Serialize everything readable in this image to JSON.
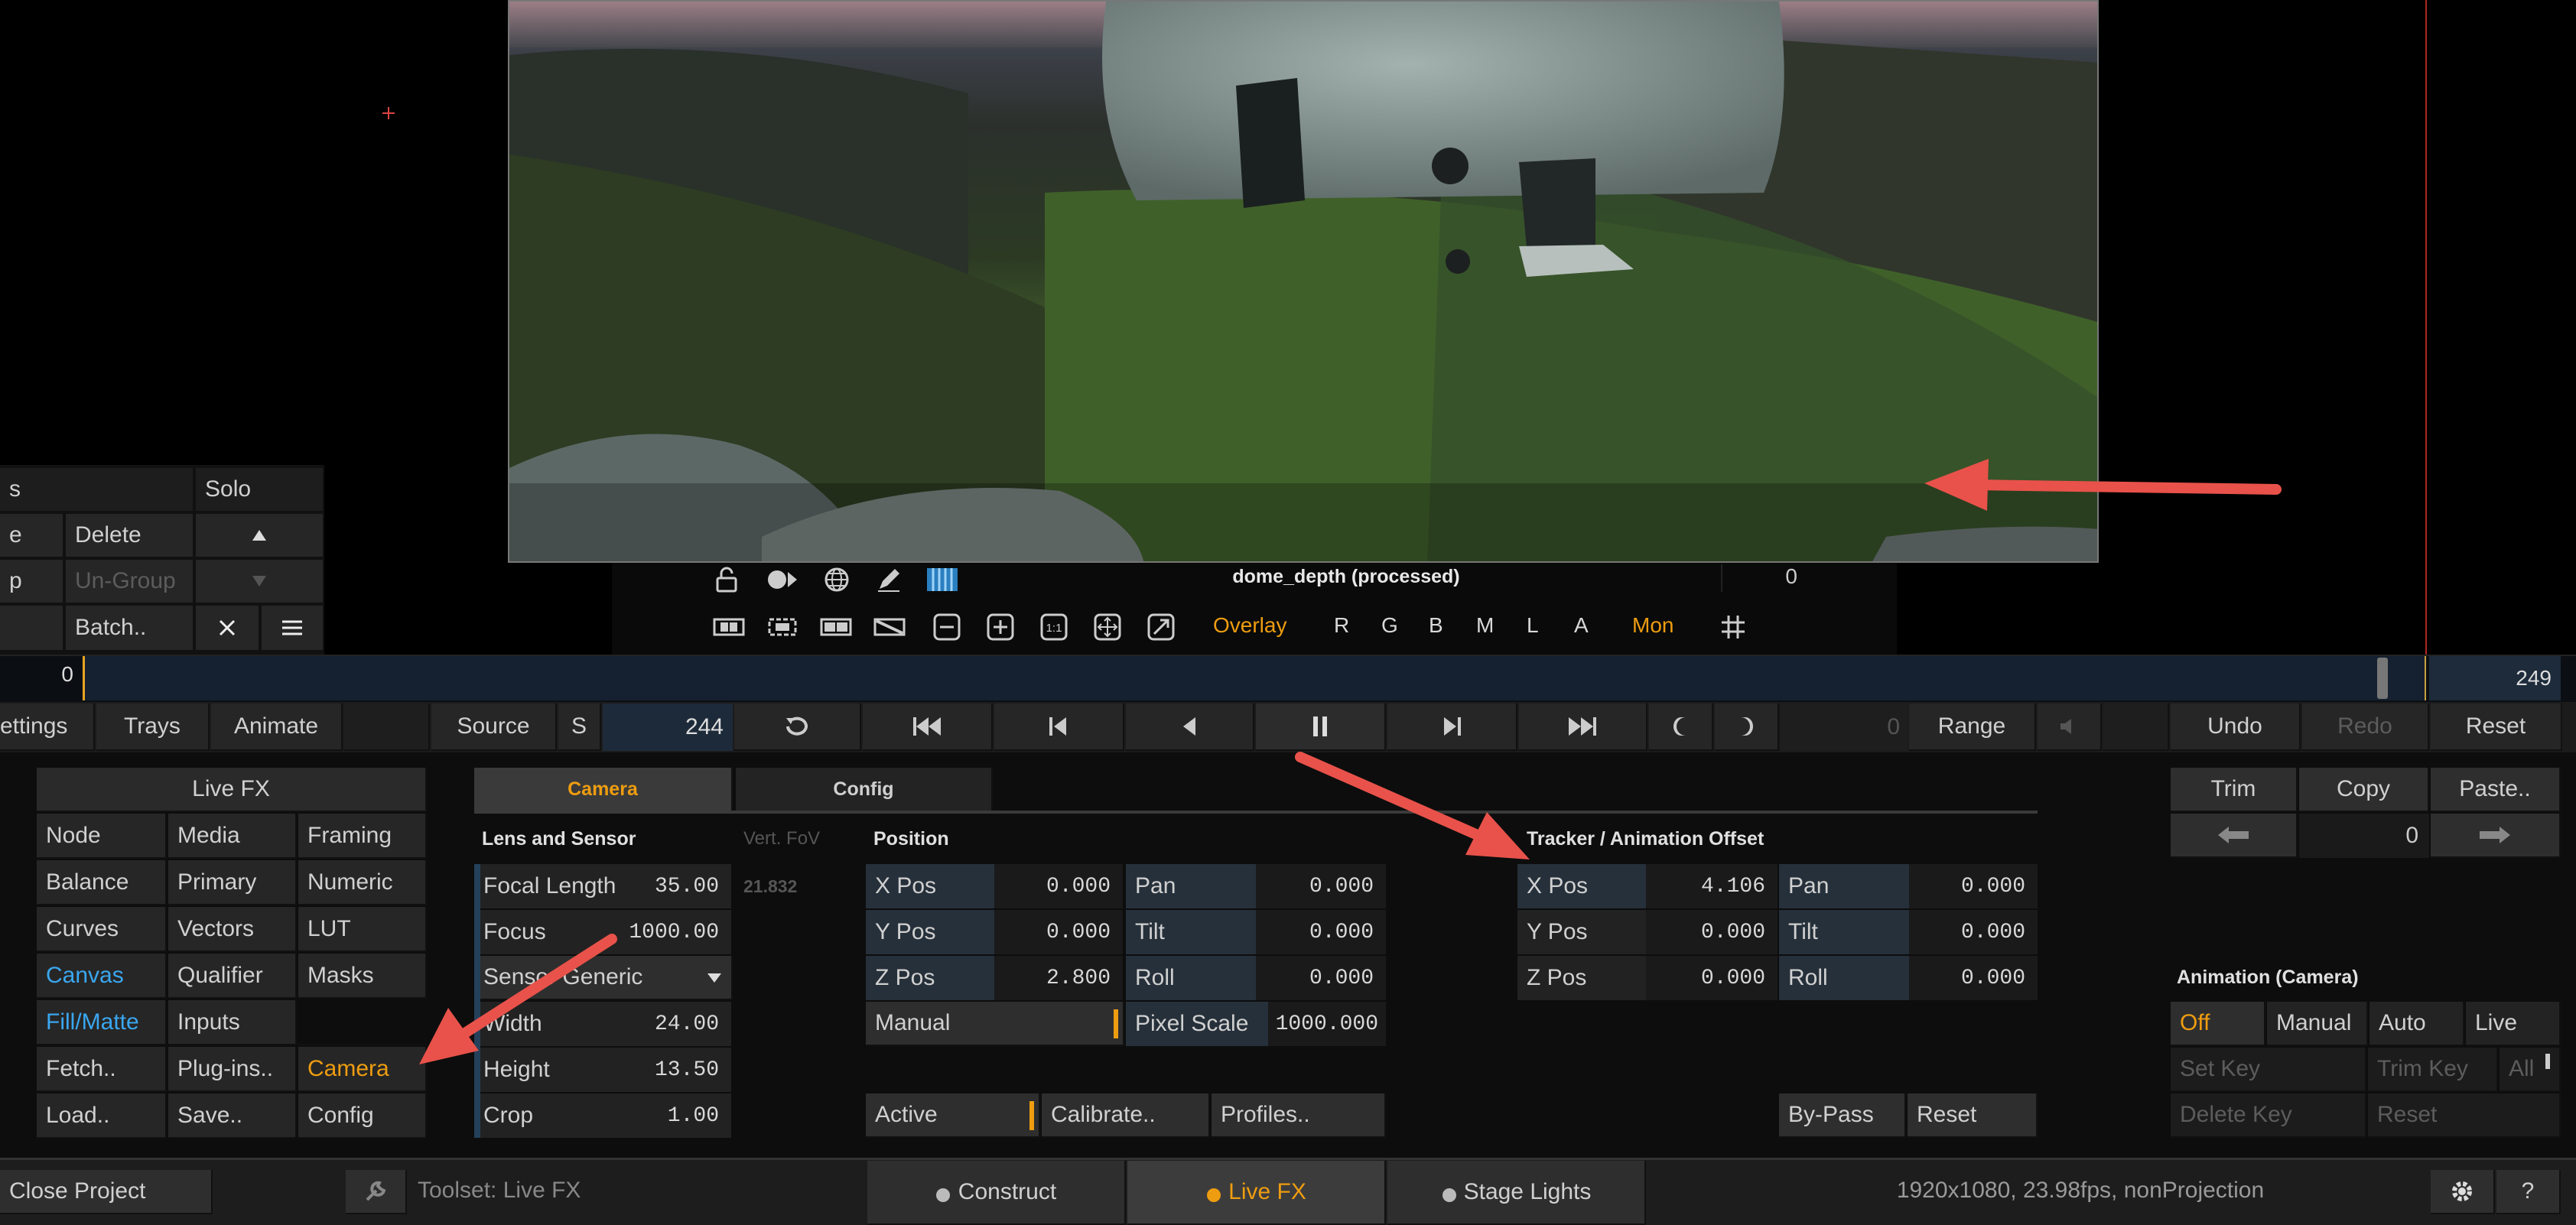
{
  "viewer": {
    "clip_name": "dome_depth (processed)",
    "frame_readout": "0",
    "overlay_label": "Overlay",
    "channels": [
      "R",
      "G",
      "B",
      "M",
      "L",
      "A"
    ],
    "mon_label": "Mon"
  },
  "left_panel": {
    "row1": {
      "a": "s",
      "solo": "Solo"
    },
    "row2": {
      "a": "e",
      "delete": "Delete"
    },
    "row3": {
      "a": "p",
      "ungroup": "Un-Group"
    },
    "row4": {
      "batch": "Batch.."
    }
  },
  "timeline": {
    "start": "0",
    "end": "249"
  },
  "transport": {
    "settings": "ettings",
    "trays": "Trays",
    "animate": "Animate",
    "source": "Source",
    "s_label": "S",
    "current_frame": "244",
    "frame_field": "0",
    "range": "Range",
    "undo": "Undo",
    "redo": "Redo",
    "reset": "Reset"
  },
  "menu": {
    "title": "Live FX",
    "items": [
      [
        "Node",
        "Media",
        "Framing"
      ],
      [
        "Balance",
        "Primary",
        "Numeric"
      ],
      [
        "Curves",
        "Vectors",
        "LUT"
      ],
      [
        "Canvas",
        "Qualifier",
        "Masks"
      ],
      [
        "Fill/Matte",
        "Inputs",
        ""
      ],
      [
        "Fetch..",
        "Plug-ins..",
        "Camera"
      ],
      [
        "Load..",
        "Save..",
        "Config"
      ]
    ]
  },
  "tabs": {
    "camera": "Camera",
    "config": "Config"
  },
  "lens": {
    "header": "Lens and Sensor",
    "vert_fov_label": "Vert. FoV",
    "vert_fov_value": "21.832",
    "focal_length": {
      "label": "Focal Length",
      "value": "35.00"
    },
    "focus": {
      "label": "Focus",
      "value": "1000.00"
    },
    "sensor": "Sensor Generic",
    "width": {
      "label": "Width",
      "value": "24.00"
    },
    "height": {
      "label": "Height",
      "value": "13.50"
    },
    "crop": {
      "label": "Crop",
      "value": "1.00"
    }
  },
  "position": {
    "header": "Position",
    "xpos": {
      "label": "X Pos",
      "value": "0.000"
    },
    "ypos": {
      "label": "Y Pos",
      "value": "0.000"
    },
    "zpos": {
      "label": "Z Pos",
      "value": "2.800"
    },
    "pan": {
      "label": "Pan",
      "value": "0.000"
    },
    "tilt": {
      "label": "Tilt",
      "value": "0.000"
    },
    "roll": {
      "label": "Roll",
      "value": "0.000"
    },
    "manual": "Manual",
    "pixel_scale": {
      "label": "Pixel Scale",
      "value": "1000.000"
    },
    "active": "Active",
    "calibrate": "Calibrate..",
    "profiles": "Profiles.."
  },
  "tracker": {
    "header": "Tracker / Animation Offset",
    "xpos": {
      "label": "X Pos",
      "value": "4.106"
    },
    "ypos": {
      "label": "Y Pos",
      "value": "0.000"
    },
    "zpos": {
      "label": "Z Pos",
      "value": "0.000"
    },
    "pan": {
      "label": "Pan",
      "value": "0.000"
    },
    "tilt": {
      "label": "Tilt",
      "value": "0.000"
    },
    "roll": {
      "label": "Roll",
      "value": "0.000"
    },
    "bypass": "By-Pass",
    "reset": "Reset"
  },
  "right_panel": {
    "trim": "Trim",
    "copy": "Copy",
    "paste": "Paste..",
    "offset_value": "0",
    "anim_header": "Animation (Camera)",
    "modes": [
      "Off",
      "Manual",
      "Auto",
      "Live"
    ],
    "set_key": "Set Key",
    "trim_key": "Trim Key",
    "all": "All",
    "delete_key": "Delete Key",
    "reset": "Reset"
  },
  "status": {
    "close_project": "Close Project",
    "toolset": "Toolset: Live FX",
    "tabs": [
      "Construct",
      "Live FX",
      "Stage Lights"
    ],
    "info": "1920x1080, 23.98fps, nonProjection",
    "help": "?"
  },
  "colors": {
    "accent_blue": "#3aa7f0",
    "accent_orange": "#ee9d10",
    "annotation_red": "#e8524a"
  }
}
